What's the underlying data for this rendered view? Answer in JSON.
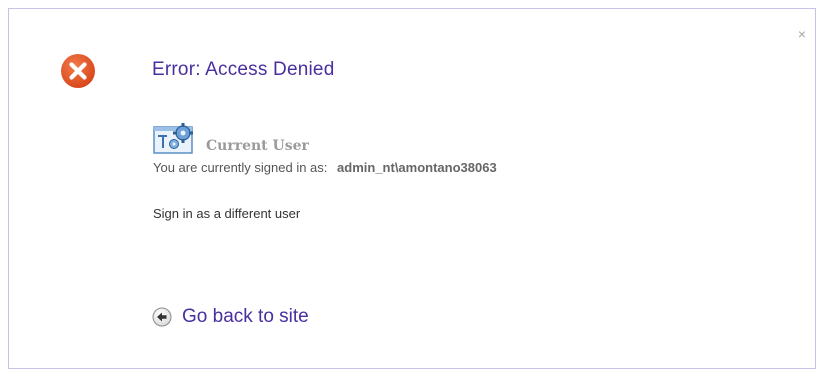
{
  "dialog": {
    "close_glyph": "×",
    "title": "Error: Access Denied",
    "error_icon": "error-x-icon",
    "current_user": {
      "icon": "user-settings-icon",
      "heading": "Current User",
      "signed_in_label": "You are currently signed in as:",
      "username": "admin_nt\\amontano38063"
    },
    "sign_in_different": "Sign in as a different user",
    "go_back": {
      "icon": "back-arrow-icon",
      "label": "Go back to site"
    }
  },
  "colors": {
    "accent": "#4a2fa0",
    "error": "#e0572a",
    "border": "#c9bfe8"
  }
}
